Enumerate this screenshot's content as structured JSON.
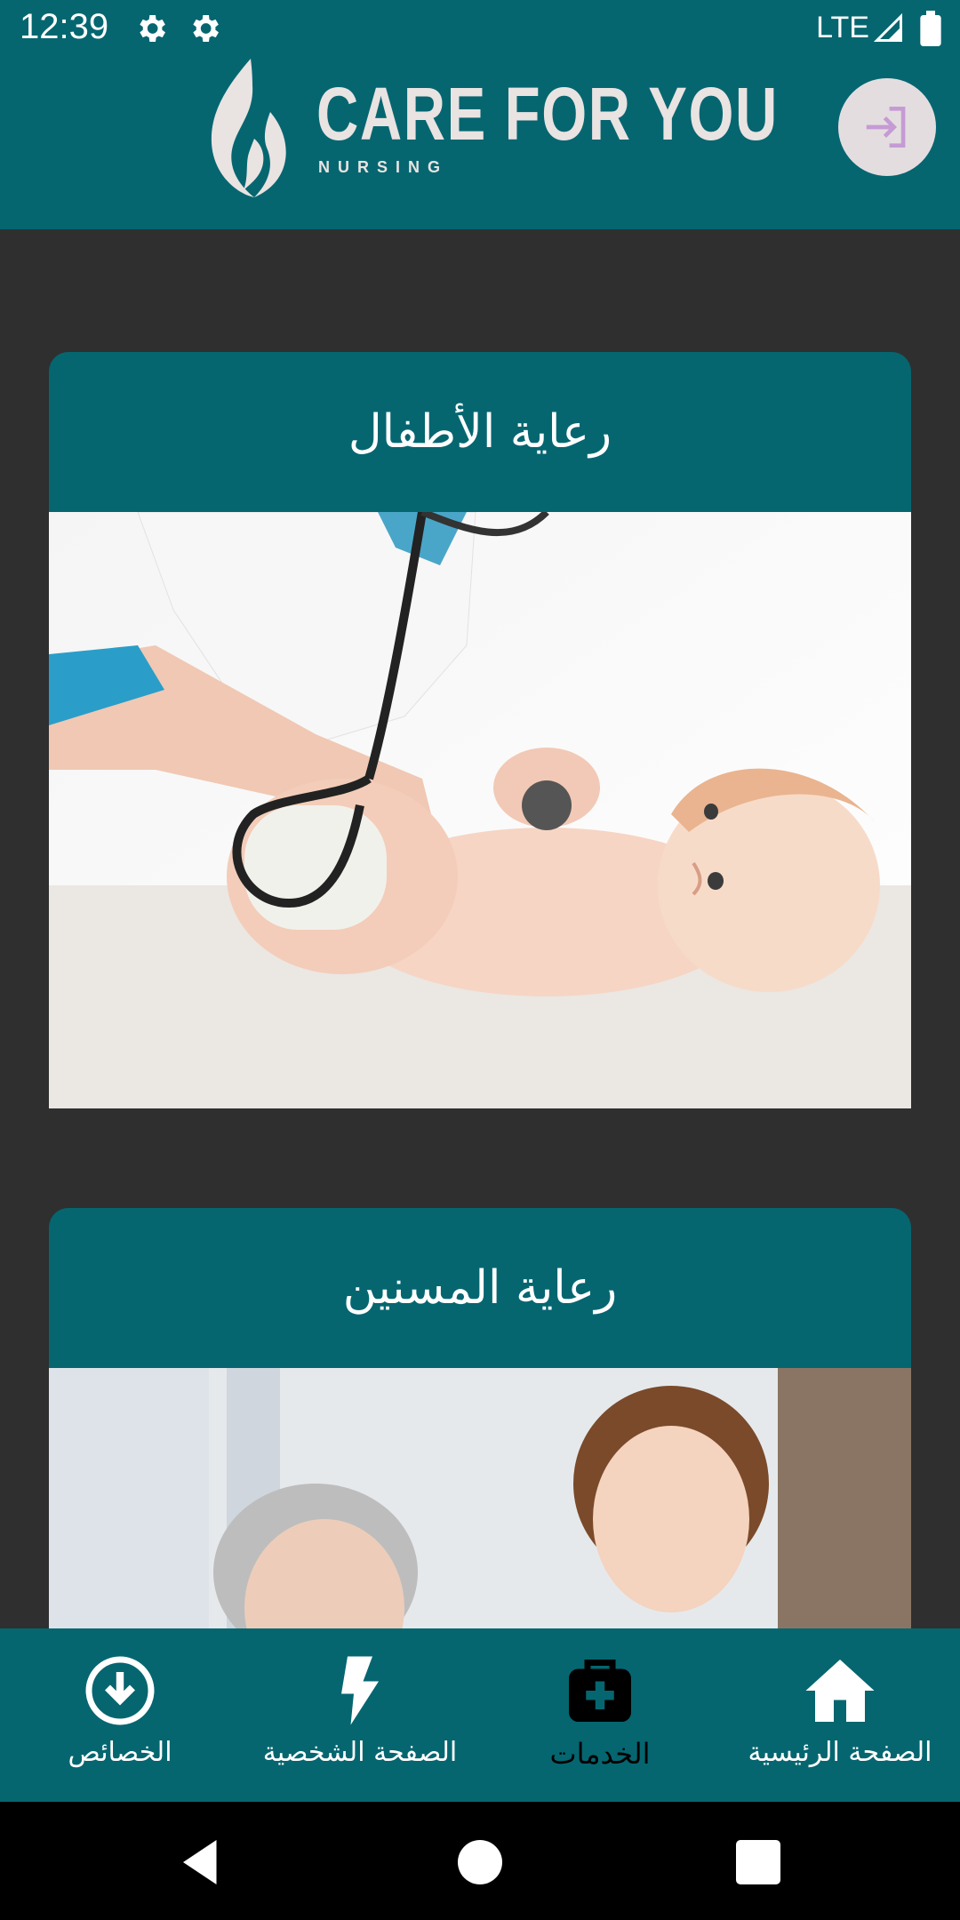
{
  "status_bar": {
    "time": "12:39",
    "network": "LTE",
    "icons": [
      "settings-gear-icon",
      "settings-gear-icon",
      "signal-icon",
      "battery-icon"
    ]
  },
  "header": {
    "brand": "CARE FOR YOU",
    "brand_sub": "NURSING",
    "login_icon": "login-icon",
    "color": "#056670"
  },
  "cards": [
    {
      "title": "رعاية الأطفال",
      "image": "pediatric-care-photo"
    },
    {
      "title": "رعاية المسنين",
      "image": "elderly-care-photo"
    }
  ],
  "bottom_nav": {
    "items": [
      {
        "label": "الخصائص",
        "icon": "download-circle-icon",
        "active": false
      },
      {
        "label": "الصفحة الشخصية",
        "icon": "bolt-icon",
        "active": false
      },
      {
        "label": "الخدمات",
        "icon": "medical-kit-icon",
        "active": true
      },
      {
        "label": "الصفحة الرئيسية",
        "icon": "home-icon",
        "active": false
      }
    ]
  },
  "system_nav": {
    "back": "back-icon",
    "home": "home-circle-icon",
    "recents": "recents-icon"
  },
  "colors": {
    "primary": "#056670",
    "background": "#2f2f2f",
    "login_button": "#e4dde0",
    "login_icon": "#c59bd4"
  }
}
